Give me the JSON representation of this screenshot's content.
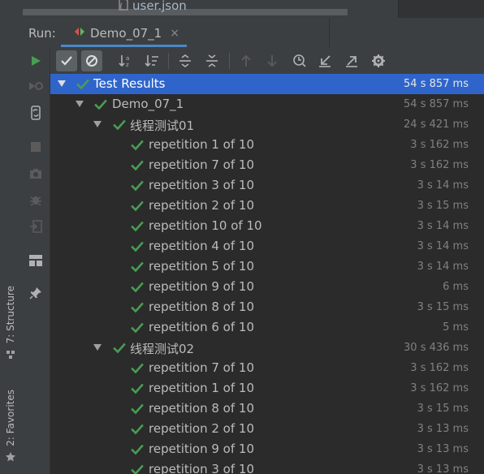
{
  "top_strip": {
    "file_tab_label": "user.json",
    "file_icon": "file-json-icon"
  },
  "left_bar": {
    "structure_label": "7: Structure",
    "favorites_label": "2: Favorites",
    "structure_icon": "structure-icon",
    "favorites_icon": "star-icon"
  },
  "run_header": {
    "label": "Run:",
    "tab_label": "Demo_07_1",
    "tab_close": "×"
  },
  "action_bar": [
    "rerun-icon",
    "rerun-failed-icon",
    "toggle-auto-test-icon",
    "stop-icon",
    "screenshot-icon",
    "debug-icon",
    "exit-icon",
    "layout-icon",
    "pin-icon"
  ],
  "toolbar": [
    "show-passed-icon",
    "show-ignored-icon",
    "sort-alphabetically-icon",
    "sort-by-duration-icon",
    "expand-all-icon",
    "collapse-all-icon",
    "previous-failed-icon",
    "next-failed-icon",
    "test-history-icon",
    "import-tests-icon",
    "export-tests-icon",
    "settings-icon"
  ],
  "tree": {
    "root": {
      "label": "Test Results",
      "time": "54 s 857 ms"
    },
    "suite": {
      "label": "Demo_07_1",
      "time": "54 s 857 ms"
    },
    "groups": [
      {
        "label": "线程测试01",
        "time": "24 s 421 ms",
        "tests": [
          {
            "label": "repetition 1 of 10",
            "time": "3 s 162 ms"
          },
          {
            "label": "repetition 7 of 10",
            "time": "3 s 162 ms"
          },
          {
            "label": "repetition 3 of 10",
            "time": "3 s 14 ms"
          },
          {
            "label": "repetition 2 of 10",
            "time": "3 s 15 ms"
          },
          {
            "label": "repetition 10 of 10",
            "time": "3 s 14 ms"
          },
          {
            "label": "repetition 4 of 10",
            "time": "3 s 14 ms"
          },
          {
            "label": "repetition 5 of 10",
            "time": "3 s 14 ms"
          },
          {
            "label": "repetition 9 of 10",
            "time": "6 ms"
          },
          {
            "label": "repetition 8 of 10",
            "time": "3 s 15 ms"
          },
          {
            "label": "repetition 6 of 10",
            "time": "5 ms"
          }
        ]
      },
      {
        "label": "线程测试02",
        "time": "30 s 436 ms",
        "tests": [
          {
            "label": "repetition 7 of 10",
            "time": "3 s 162 ms"
          },
          {
            "label": "repetition 1 of 10",
            "time": "3 s 162 ms"
          },
          {
            "label": "repetition 8 of 10",
            "time": "3 s 15 ms"
          },
          {
            "label": "repetition 2 of 10",
            "time": "3 s 13 ms"
          },
          {
            "label": "repetition 9 of 10",
            "time": "3 s 13 ms"
          },
          {
            "label": "repetition 3 of 10",
            "time": "3 s 13 ms"
          }
        ]
      }
    ]
  },
  "colors": {
    "pass": "#499c54",
    "selection": "#2f65ca",
    "accent": "#4a88c7"
  }
}
